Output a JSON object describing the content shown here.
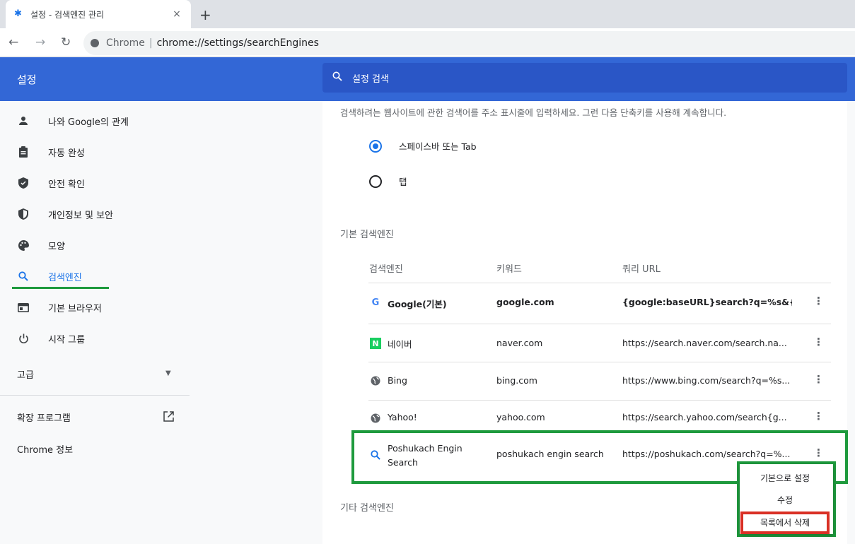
{
  "browser": {
    "tab_title": "설정 - 검색엔진 관리",
    "tab_close": "×",
    "new_tab": "+",
    "scheme_label": "Chrome",
    "url": "chrome://settings/searchEngines"
  },
  "header": {
    "title": "설정",
    "search_placeholder": "설정 검색"
  },
  "sidebar": {
    "items": [
      {
        "label": "나와 Google의 관계",
        "icon": "person-icon"
      },
      {
        "label": "자동 완성",
        "icon": "clipboard-icon"
      },
      {
        "label": "안전 확인",
        "icon": "shield-check-icon"
      },
      {
        "label": "개인정보 및 보안",
        "icon": "shield-icon"
      },
      {
        "label": "모양",
        "icon": "palette-icon"
      },
      {
        "label": "검색엔진",
        "icon": "search-icon",
        "active": true
      },
      {
        "label": "기본 브라우저",
        "icon": "browser-icon"
      },
      {
        "label": "시작 그룹",
        "icon": "power-icon"
      }
    ],
    "advanced": "고급",
    "extensions": "확장 프로그램",
    "about": "Chrome 정보"
  },
  "main": {
    "description": "검색하려는 웹사이트에 관한 검색어를 주소 표시줄에 입력하세요. 그런 다음 단축키를 사용해 계속합니다.",
    "radio_options": [
      {
        "label": "스페이스바 또는 Tab",
        "selected": true
      },
      {
        "label": "탭",
        "selected": false
      }
    ],
    "default_section_title": "기본 검색엔진",
    "other_section_title": "기타 검색엔진",
    "columns": {
      "engine": "검색엔진",
      "keyword": "키워드",
      "url": "쿼리 URL"
    },
    "engines": [
      {
        "name": "Google(기본)",
        "keyword": "google.com",
        "url": "{google:baseURL}search?q=%s&{go...",
        "icon": "google-icon",
        "bold": true
      },
      {
        "name": "네이버",
        "keyword": "naver.com",
        "url": "https://search.naver.com/search.na...",
        "icon": "naver-icon",
        "bold": false
      },
      {
        "name": "Bing",
        "keyword": "bing.com",
        "url": "https://www.bing.com/search?q=%s...",
        "icon": "globe-icon",
        "bold": false
      },
      {
        "name": "Yahoo!",
        "keyword": "yahoo.com",
        "url": "https://search.yahoo.com/search{g...",
        "icon": "globe-icon",
        "bold": false
      },
      {
        "name": "Poshukach Engin Search",
        "keyword": "poshukach engin search",
        "url": "https://poshukach.com/search?q=%...",
        "icon": "search-icon",
        "bold": false
      }
    ]
  },
  "context_menu": {
    "items": [
      "기본으로 설정",
      "수정",
      "목록에서 삭제"
    ]
  },
  "colors": {
    "accent": "#1a73e8",
    "header_blue": "#3367d6",
    "highlight_green": "#1e9a3d",
    "highlight_red": "#d93025"
  }
}
